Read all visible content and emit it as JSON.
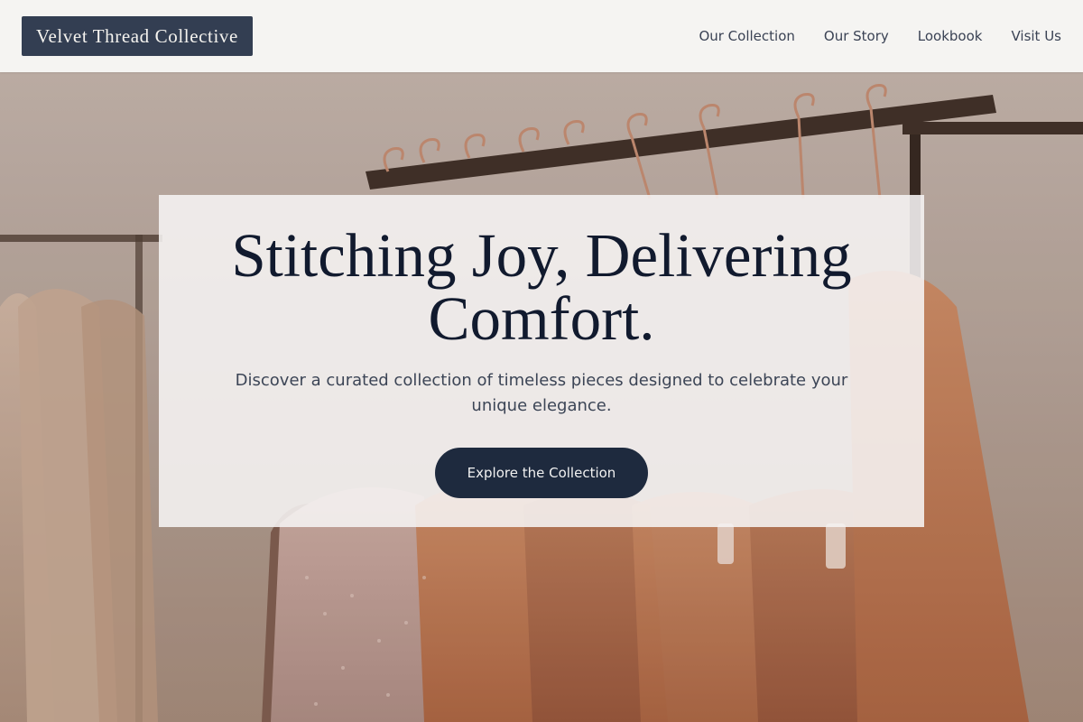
{
  "brand": {
    "name": "Velvet Thread Collective"
  },
  "nav": {
    "items": [
      {
        "label": "Our Collection"
      },
      {
        "label": "Our Story"
      },
      {
        "label": "Lookbook"
      },
      {
        "label": "Visit Us"
      }
    ]
  },
  "hero": {
    "headline_line1": "Stitching Joy, Delivering",
    "headline_line2": "Comfort.",
    "subtext": "Discover a curated collection of timeless pieces designed to celebrate your unique elegance.",
    "cta_label": "Explore the Collection",
    "image_subject": "clothing-rack-with-garments"
  },
  "colors": {
    "header_bg": "#f5f4f2",
    "logo_bg": "#333e52",
    "headline": "#111a2e",
    "cta_bg": "#1e2a3e"
  }
}
